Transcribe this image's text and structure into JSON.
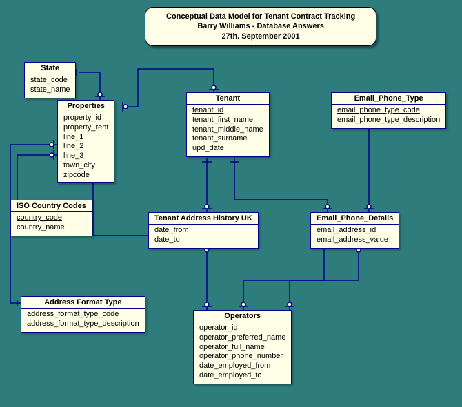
{
  "title": {
    "line1": "Conceptual Data Model for Tenant Contract Tracking",
    "line2": "Barry Williams - Database Answers",
    "line3": "27th. September 2001"
  },
  "entities": {
    "state": {
      "name": "State",
      "attrs": [
        {
          "name": "state_code",
          "pk": true
        },
        {
          "name": "state_name",
          "pk": false
        }
      ]
    },
    "properties": {
      "name": "Properties",
      "attrs": [
        {
          "name": "property_id",
          "pk": true
        },
        {
          "name": "property_rent",
          "pk": false
        },
        {
          "name": "line_1",
          "pk": false
        },
        {
          "name": "line_2",
          "pk": false
        },
        {
          "name": "line_3",
          "pk": false
        },
        {
          "name": "town_city",
          "pk": false
        },
        {
          "name": "zipcode",
          "pk": false
        }
      ]
    },
    "iso": {
      "name": "ISO Country Codes",
      "attrs": [
        {
          "name": "country_code",
          "pk": true
        },
        {
          "name": "country_name",
          "pk": false
        }
      ]
    },
    "aft": {
      "name": "Address Format Type",
      "attrs": [
        {
          "name": "address_format_type_code",
          "pk": true
        },
        {
          "name": "address_format_type_description",
          "pk": false
        }
      ]
    },
    "tenant": {
      "name": "Tenant",
      "attrs": [
        {
          "name": "tenant_id",
          "pk": true
        },
        {
          "name": "tenant_first_name",
          "pk": false
        },
        {
          "name": "tenant_middle_name",
          "pk": false
        },
        {
          "name": "tenant_surname",
          "pk": false
        },
        {
          "name": "upd_date",
          "pk": false
        }
      ]
    },
    "tah": {
      "name": "Tenant Address History UK",
      "attrs": [
        {
          "name": "date_from",
          "pk": false
        },
        {
          "name": "date_to",
          "pk": false
        }
      ]
    },
    "ept": {
      "name": "Email_Phone_Type",
      "attrs": [
        {
          "name": "email_phone_type_code",
          "pk": true
        },
        {
          "name": "email_phone_type_description",
          "pk": false
        }
      ]
    },
    "epd": {
      "name": "Email_Phone_Details",
      "attrs": [
        {
          "name": "email_address_id",
          "pk": true
        },
        {
          "name": "email_address_value",
          "pk": false
        }
      ]
    },
    "operators": {
      "name": "Operators",
      "attrs": [
        {
          "name": "operator_id",
          "pk": true
        },
        {
          "name": "operator_preferred_name",
          "pk": false
        },
        {
          "name": "operator_full_name",
          "pk": false
        },
        {
          "name": "operator_phone_number",
          "pk": false
        },
        {
          "name": "date_employed_from",
          "pk": false
        },
        {
          "name": "date_employed_to",
          "pk": false
        }
      ]
    }
  }
}
